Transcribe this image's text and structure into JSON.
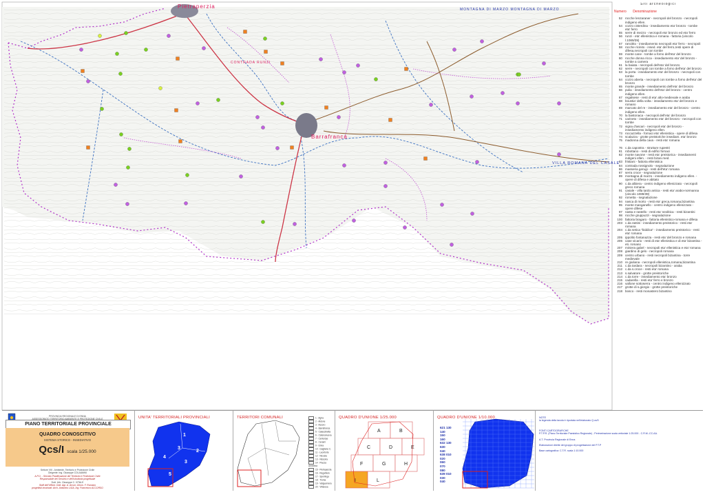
{
  "map": {
    "labels": {
      "pietraperzia": "Pietraperzia",
      "barrafranca": "Barrafranca",
      "contrada": "CONTRADA RUNZI",
      "montagna": "MONTAGNA DI MARZO MONTAGNA DI MARZO",
      "villa": "VILLA ROMANA DEL CASALE"
    },
    "colors": {
      "road_red": "#cc3344",
      "road_brown": "#8b5a2b",
      "boundary_blue": "#3a6fc0",
      "boundary_purple": "#a020c0",
      "site_green": "#7ad020",
      "site_violet": "#c060e0",
      "site_orange": "#f08020",
      "site_yellow": "#d8f040"
    }
  },
  "legend": {
    "title": "Siti archeologici",
    "col_num": "Numero",
    "col_name": "Denominazione",
    "entries": [
      {
        "n": "52",
        "t": "rocche lenzaraner - necropoli del bronzo - necropoli indigeno ellen."
      },
      {
        "n": "54",
        "t": "cozzo cisterdina - insediamento eta' bronzo - tombe eta' ferro"
      },
      {
        "n": "55",
        "t": "serre di mezzo - necropoli eta' bronzo ed eta' ferro"
      },
      {
        "n": "56",
        "t": "runzi - eta' ellenistica e romana - fattoria (vincolo l.1089/39)"
      },
      {
        "n": "57",
        "t": "rancitito - insediamento necropoli eta' ferro - necropoli"
      },
      {
        "n": "58",
        "t": "rocche ricinito - insed. eta' del ferro,resti opere di difesa,necropoli con tombe"
      },
      {
        "n": "59",
        "t": "monte cane - tombe a forno dell'eta' del bronzo"
      },
      {
        "n": "60",
        "t": "rocche donna ricca - insediamento eta' del bronzo - tombe a camera"
      },
      {
        "n": "61",
        "t": "la baiata - necropoli dell'eta' del bronzo"
      },
      {
        "n": "62",
        "t": "serre - necropoli con tombe a forno dell'eta' del bronzo"
      },
      {
        "n": "63",
        "t": "la porta - insediamento eta' del bronzo - necropoli con tombe"
      },
      {
        "n": "64",
        "t": "cozzo aberta - necropoli con tombe a forno dell'eta' del bronzo"
      },
      {
        "n": "65",
        "t": "monte grande - insediamento dell'eta' del bronzo"
      },
      {
        "n": "66",
        "t": "pulia - insediamento dell'eta' del bronzo - centro indigeno ellen."
      },
      {
        "n": "67",
        "t": "regalsese - resti di eta' alto-medievale e araba"
      },
      {
        "n": "68",
        "t": "boustia' della volta - insediamento eta' del bronzo e romano"
      },
      {
        "n": "69",
        "t": "marcato del re - insediamento eta' del bronzo - centro indigeno ellen."
      },
      {
        "n": "70",
        "t": "la bastonaca - necropoli dell'eta' del bronzo"
      },
      {
        "n": "71",
        "t": "carineto - insediamento eta' del bronzo - necropoli con tombe"
      },
      {
        "n": "72",
        "t": "vigna d'ascari - necropoli eta' del bronzo - insediamento indigeno ellen."
      },
      {
        "n": "73",
        "t": "roccazzella - fornaci eta' ellenistica - opere di difesa"
      },
      {
        "n": "74",
        "t": "scalazza - grotte preistoriche insediam. eta' bronzo"
      },
      {
        "n": "75",
        "t": "madonna della cava - resti eta' romana"
      },
      {
        "n": "76",
        "t": "c.da capostra - strutture rupestri"
      },
      {
        "n": "81",
        "t": "robottano - resti di edifici fornaci"
      },
      {
        "n": "82",
        "t": "monte navone - resti eta' preistorica - insediamenti indigeni ellen. - resti bizan.med."
      },
      {
        "n": "83",
        "t": "fristiani - fattoria ellenistica"
      },
      {
        "n": "84",
        "t": "contrada rossignolo - segnalazione"
      },
      {
        "n": "86",
        "t": "masseria gerugi - resti dell'eta' romana"
      },
      {
        "n": "87",
        "t": "serra croce - segnalazione"
      },
      {
        "n": "89",
        "t": "montagna di marzo - insediamento indigeno ellen. - opere di difesa e abitato"
      },
      {
        "n": "90",
        "t": "c.da albiera - centro indigeno ellenizzato - necropoli greco romana"
      },
      {
        "n": "91",
        "t": "casale - villa tardo antica - resti eta' arabo-normanna (vincolo 1089/39)"
      },
      {
        "n": "92",
        "t": "rometta - segnalazione"
      },
      {
        "n": "94",
        "t": "nasca di morto - resti eta' greca,romana,bizantina"
      },
      {
        "n": "95",
        "t": "monte manganello - centro indigeno ellenizzato - opere difese"
      },
      {
        "n": "97",
        "t": "nasta e rastello - resti eta' neolitica - resti bizantini"
      },
      {
        "n": "98",
        "t": "rocche gruppuzzi - segnalazione"
      },
      {
        "n": "100",
        "t": "fattoria bragaro - fattoria ellenistico-romana e difesa"
      },
      {
        "n": "203",
        "t": "c.da rastini - insediamento preistorico - resti eta' romana"
      },
      {
        "n": "204",
        "t": "c.da setica \"biddica\" - insediamento preistorico - resti eta' romana"
      },
      {
        "n": "205",
        "t": "ippolito fontanazza - resti eta' del bronzo e romana"
      },
      {
        "n": "206",
        "t": "case vicario - resti di eta' ellenistica e di eta' bizantina - eti. romano"
      },
      {
        "n": "207",
        "t": "miniera gabel - necropoli eta' ellenistica e eta' romana"
      },
      {
        "n": "208",
        "t": "giardino di gelo - necropoli romana"
      },
      {
        "n": "209",
        "t": "centro urbano - resti necropoli bizantina - torre medievale"
      },
      {
        "n": "210",
        "t": "re giuliana - necropoli ellenistica,romana,bizantina"
      },
      {
        "n": "211",
        "t": "c.da tardara - necropoli bizantino - araba"
      },
      {
        "n": "212",
        "t": "c.da s.croce - resti eta' romana"
      },
      {
        "n": "213",
        "t": "s.salvatore - grotte preistoriche"
      },
      {
        "n": "214",
        "t": "c.da torre - insediamento eta' bronzo"
      },
      {
        "n": "215",
        "t": "cadarella - resti eta' ferro e bronzo"
      },
      {
        "n": "216",
        "t": "vallone sottoserra - centro indigeno ellenizzato"
      },
      {
        "n": "217",
        "t": "grotte di s.giorgio - grotte preistoriche"
      },
      {
        "n": "218",
        "t": "bosco - resti monastero bizantino"
      }
    ]
  },
  "titleblock": {
    "region_l1": "PROVINCIA REGIONALE DI ENNA",
    "region_l2": "ASSESSORATO TERRITORIO AMBIENTE E PROTEZIONE CIVILE",
    "plan_title": "PIANO TERRITORIALE PROVINCIALE",
    "qc_title": "QUADRO CONOSCITIVO",
    "qc_sub": "SISTEMA STORICO - INSEDIATIVO",
    "code": "Qcs/I",
    "scale": "scala 1/25.000",
    "credit_1": "Settore VIII - Ambiente, Territorio e Protezione Civile",
    "credit_2": "Dirigente: Ing. Giuseppe COLAIANNI",
    "credit_3": "A.P.O. - Servizio Pianificazione del Territorio e Protezione Civile",
    "credit_4": "Responsabile del Servizio e dell'istruttoria progettuale",
    "credit_5": "Dott. Urb. Giuseppe C. VITALE",
    "credit_6": "Staff dell'Ufficio: Dott. Agr. A. Arcuri, Geom. F. Romano",
    "credit_7": "progettisti incaricati: Arch. Antonino LIGA, Ing. Francesco ACCORSO",
    "panel_unita": "UNITA' TERRITORIALI PROVINCIALI",
    "panel_comunali": "TERRITORI COMUNALI",
    "panel_unione25": "QUADRO D'UNIONE 1/25.000",
    "panel_unione10": "QUADRO D'UNIONE 1/10.000",
    "unita_nums": [
      "1",
      "2",
      "3",
      "3",
      "4",
      "5"
    ],
    "comuni": [
      "1 - Agira",
      "2 - Aidone",
      "3 - Assoro",
      "4 - Barrafranca",
      "5 - Calascibetta",
      "6 - Catenanuova",
      "7 - Centuripe",
      "8 - Cerami",
      "9 - Enna",
      "10 - Gagliano C.",
      "11 - Leonforte",
      "12 - Nicosia",
      "13 - Nissoria",
      "14 - Piazza Armerina",
      "15 - Pietraperzia",
      "16 - Regalbuto",
      "17 - Sperlinga",
      "18 - Troina",
      "19 - Valguarnera",
      "20 - Villarosa"
    ],
    "grid_letters": [
      "A",
      "B",
      "C",
      "D",
      "E",
      "F",
      "G",
      "H",
      "I",
      "L"
    ],
    "coords": [
      "621 130",
      "140",
      "150",
      "160",
      "632 130",
      "630",
      "040",
      "638 010",
      "020",
      "060",
      "070",
      "080",
      "639 010",
      "030",
      "040"
    ],
    "notes_title": "NOTE",
    "notes_1": "la legenda della tavola è riportata nell'elaborato Q.cs/0",
    "fonti_title": "FONTI CARTOGRAFICHE",
    "fonti_1": "P.T.P.R. (Piano Territoriale Paesistico Regionale) - Perimetrazione scala vettoriale 1:25.000 - C.R.M.-CC.AA.",
    "fonti_2": "A.T. Provincia Regionale di Enna",
    "fonti_3": "Elaborazioni dirette del gruppo di progettazione del P.T.P",
    "fonti_4": "Base cartografica: C.T.R. scala 1:10.000"
  }
}
